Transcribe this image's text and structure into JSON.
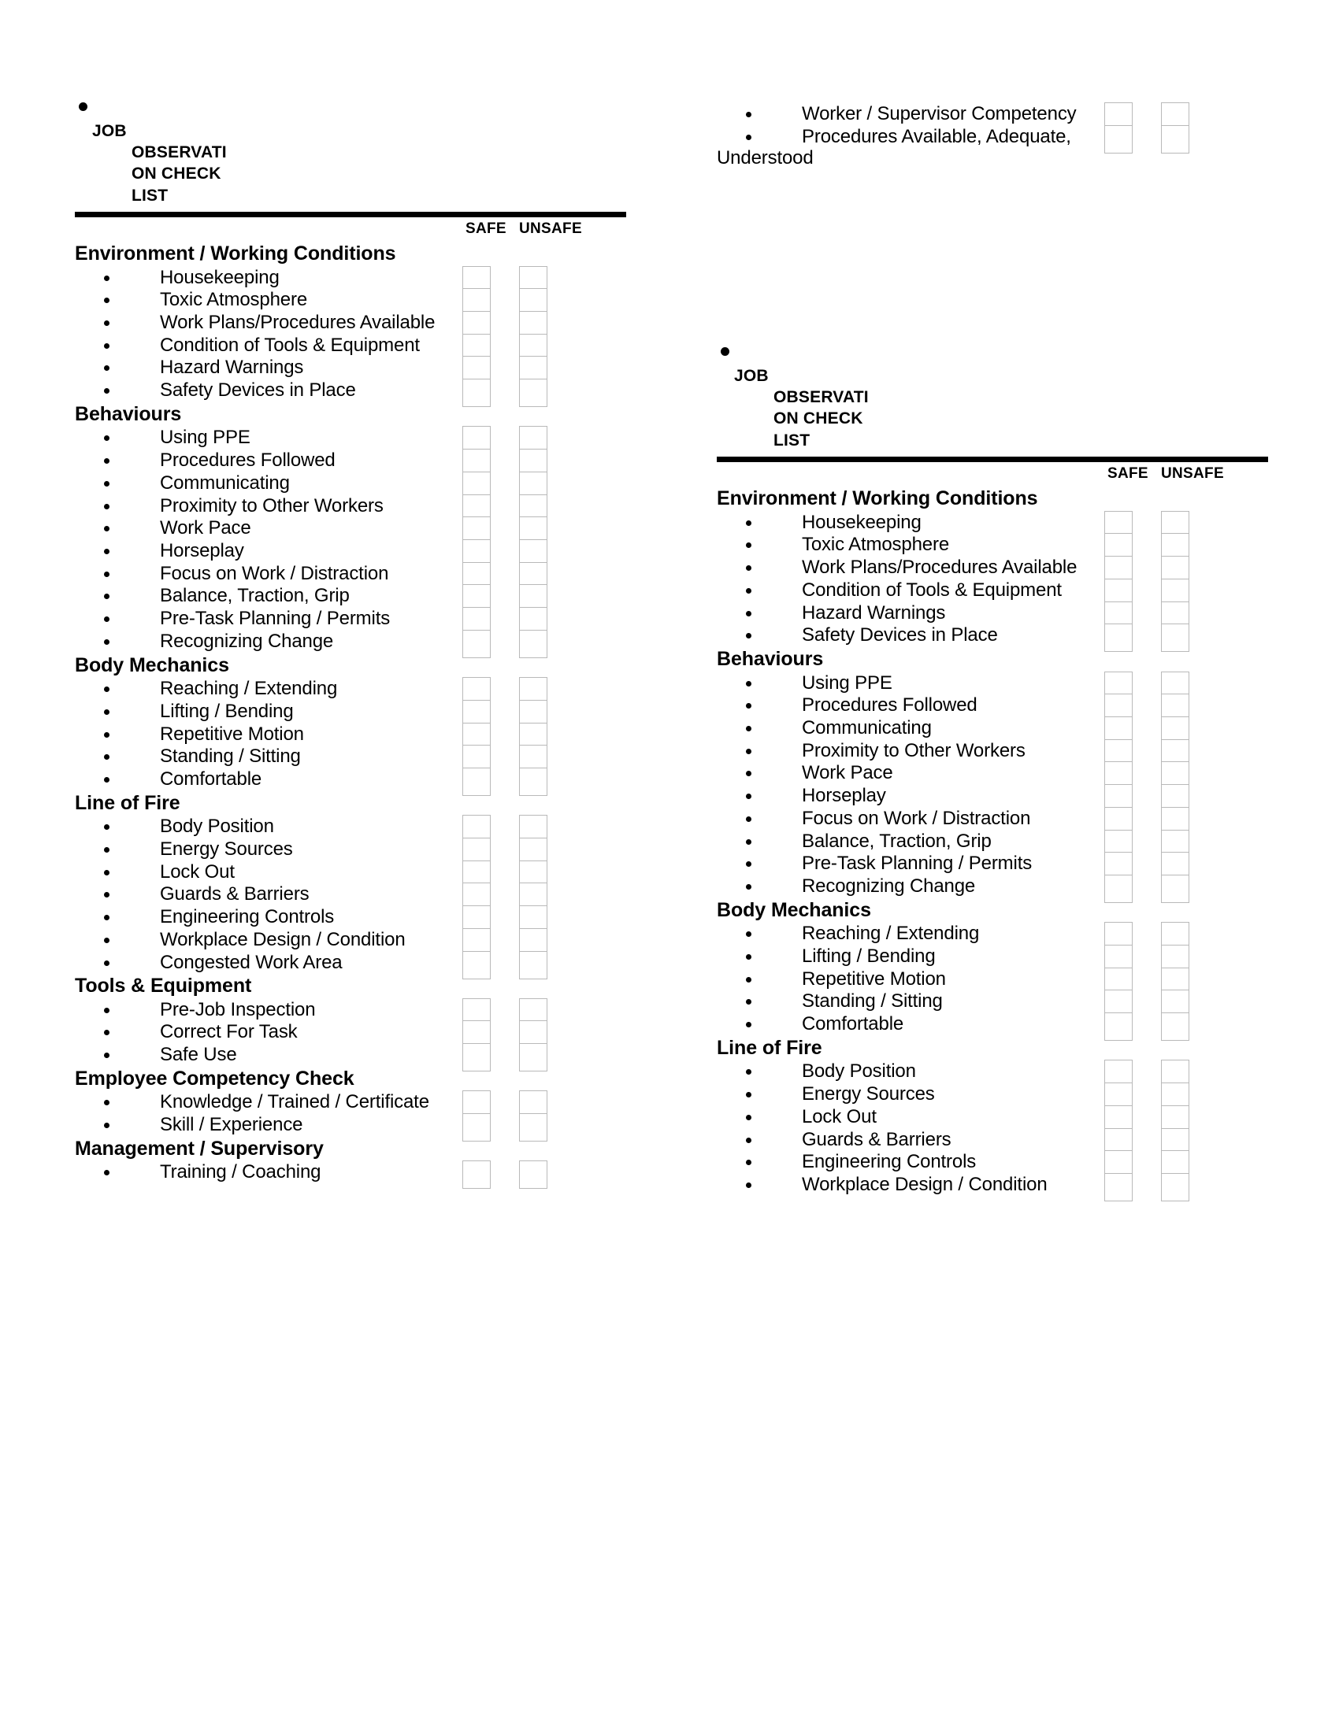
{
  "document": {
    "title_lines": [
      "JOB",
      "OBSERVAT",
      "ION",
      "CHECKLIS",
      "T"
    ],
    "title_job": "JOB",
    "title_rest": "OBSERVATION CHECKLIST",
    "column_headers": {
      "safe": "SAFE",
      "unsafe": "UNSAFE"
    }
  },
  "left_column": {
    "continued_items": [],
    "sections": [
      {
        "title": "Environment / Working Conditions",
        "items": [
          "Housekeeping",
          "Toxic Atmosphere",
          "Work Plans/Procedures Available",
          "Condition of Tools & Equipment",
          "Hazard Warnings",
          "Safety Devices in Place"
        ]
      },
      {
        "title": "Behaviours",
        "items": [
          "Using PPE",
          "Procedures Followed",
          "Communicating",
          "Proximity to Other Workers",
          "Work Pace",
          "Horseplay",
          "Focus on Work / Distraction",
          "Balance, Traction, Grip",
          "Pre-Task Planning / Permits",
          "Recognizing Change"
        ]
      },
      {
        "title": "Body Mechanics",
        "items": [
          "Reaching / Extending",
          "Lifting / Bending",
          "Repetitive Motion",
          "Standing / Sitting",
          "Comfortable"
        ]
      },
      {
        "title": "Line of Fire",
        "items": [
          "Body Position",
          "Energy Sources",
          "Lock Out",
          "Guards & Barriers",
          "Engineering Controls",
          "Workplace Design / Condition",
          "Congested Work Area"
        ]
      },
      {
        "title": "Tools & Equipment",
        "items": [
          "Pre-Job Inspection",
          "Correct For Task",
          "Safe Use"
        ]
      },
      {
        "title": "Employee Competency Check",
        "items": [
          "Knowledge / Trained / Certificate",
          "Skill / Experience"
        ]
      },
      {
        "title": "Management / Supervisory",
        "items": [
          "Training / Coaching"
        ]
      }
    ]
  },
  "right_column": {
    "continued_items": [
      "Worker / Supervisor Competency",
      "Procedures Available, Adequate, Understood"
    ],
    "sections": [
      {
        "title": "Environment / Working Conditions",
        "items": [
          "Housekeeping",
          "Toxic Atmosphere",
          "Work Plans/Procedures Available",
          "Condition of Tools & Equipment",
          "Hazard Warnings",
          "Safety Devices in Place"
        ]
      },
      {
        "title": "Behaviours",
        "items": [
          "Using PPE",
          "Procedures Followed",
          "Communicating",
          "Proximity to Other Workers",
          "Work Pace",
          "Horseplay",
          "Focus on Work / Distraction",
          "Balance, Traction, Grip",
          "Pre-Task Planning / Permits",
          "Recognizing Change"
        ]
      },
      {
        "title": "Body Mechanics",
        "items": [
          "Reaching / Extending",
          "Lifting / Bending",
          "Repetitive Motion",
          "Standing / Sitting",
          "Comfortable"
        ]
      },
      {
        "title": "Line of Fire",
        "items": [
          "Body Position",
          "Energy Sources",
          "Lock Out",
          "Guards & Barriers",
          "Engineering Controls",
          "Workplace Design / Condition"
        ]
      }
    ]
  }
}
